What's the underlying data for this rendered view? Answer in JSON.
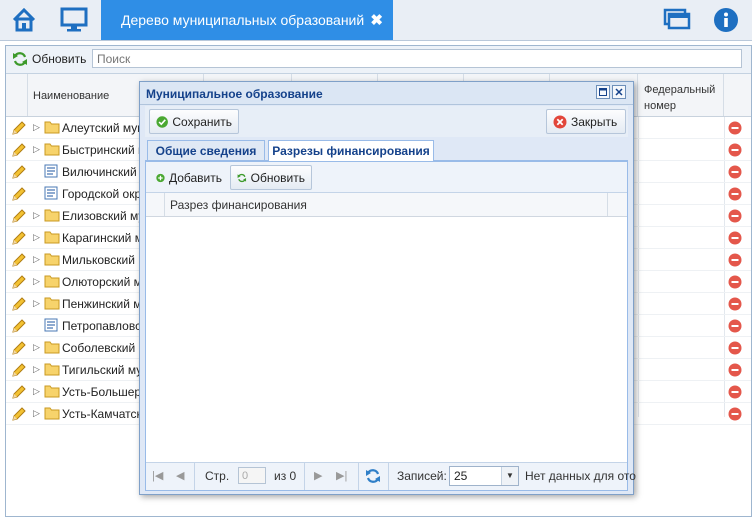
{
  "tab": {
    "title": "Дерево муниципальных образований",
    "close": "✖"
  },
  "toolbar": {
    "refresh_label": "Обновить",
    "search_placeholder": "Поиск"
  },
  "grid": {
    "col_name": "Наименование",
    "col_fed_line1": "Федеральный",
    "col_fed_line2": "номер",
    "rows": [
      {
        "name": "Алеутский муни",
        "type": "folder"
      },
      {
        "name": "Быстринский му",
        "type": "folder"
      },
      {
        "name": "Вилючинский го",
        "type": "leaf"
      },
      {
        "name": "Городской окру",
        "type": "leaf"
      },
      {
        "name": "Елизовский мун",
        "type": "folder"
      },
      {
        "name": "Карагинский му",
        "type": "folder"
      },
      {
        "name": "Мильковский му",
        "type": "folder"
      },
      {
        "name": "Олюторский му",
        "type": "folder"
      },
      {
        "name": "Пенжинский му",
        "type": "folder"
      },
      {
        "name": "Петропавловск",
        "type": "leaf"
      },
      {
        "name": "Соболевский му",
        "type": "folder"
      },
      {
        "name": "Тигильский мун",
        "type": "folder"
      },
      {
        "name": "Усть-Большере",
        "type": "folder"
      },
      {
        "name": "Усть-Камчатск",
        "type": "folder"
      }
    ]
  },
  "dialog": {
    "title": "Муниципальное образование",
    "save_label": "Сохранить",
    "close_label": "Закрыть",
    "tabs": [
      "Общие сведения",
      "Разрезы финансирования"
    ],
    "inner": {
      "add_label": "Добавить",
      "refresh_label": "Обновить",
      "column": "Разрез финансирования"
    },
    "pager": {
      "page_label": "Стр.",
      "page_value": "0",
      "of_label": "из 0",
      "records_label": "Записей:",
      "records_value": "25",
      "empty_text": "Нет данных для ото"
    }
  }
}
